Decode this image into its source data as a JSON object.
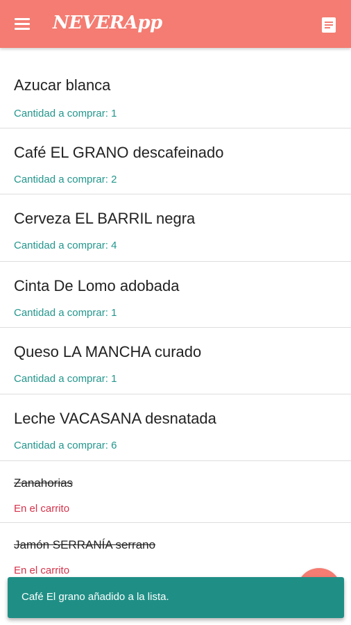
{
  "app": {
    "title": "NEVERApp",
    "accent_color": "#f47c72",
    "menu_icon": "hamburger-menu-icon",
    "list_icon": "list-icon"
  },
  "items": [
    {
      "name": "Azucar blanca",
      "status": "Cantidad a comprar: 1",
      "in_cart": false
    },
    {
      "name": "Café EL GRANO descafeinado",
      "status": "Cantidad a comprar: 2",
      "in_cart": false
    },
    {
      "name": "Cerveza EL BARRIL negra",
      "status": "Cantidad a comprar: 4",
      "in_cart": false
    },
    {
      "name": "Cinta De Lomo adobada",
      "status": "Cantidad a comprar: 1",
      "in_cart": false
    },
    {
      "name": "Queso LA MANCHA curado",
      "status": "Cantidad a comprar: 1",
      "in_cart": false
    },
    {
      "name": "Leche VACASANA desnatada",
      "status": "Cantidad a comprar: 6",
      "in_cart": false
    },
    {
      "name": "Zanahorias",
      "status": "En el carrito",
      "in_cart": true
    },
    {
      "name": "Jamón SERRANÍA serrano",
      "status": "En el carrito",
      "in_cart": true
    }
  ],
  "snackbar": {
    "message": "Café El grano añadido a la lista."
  }
}
